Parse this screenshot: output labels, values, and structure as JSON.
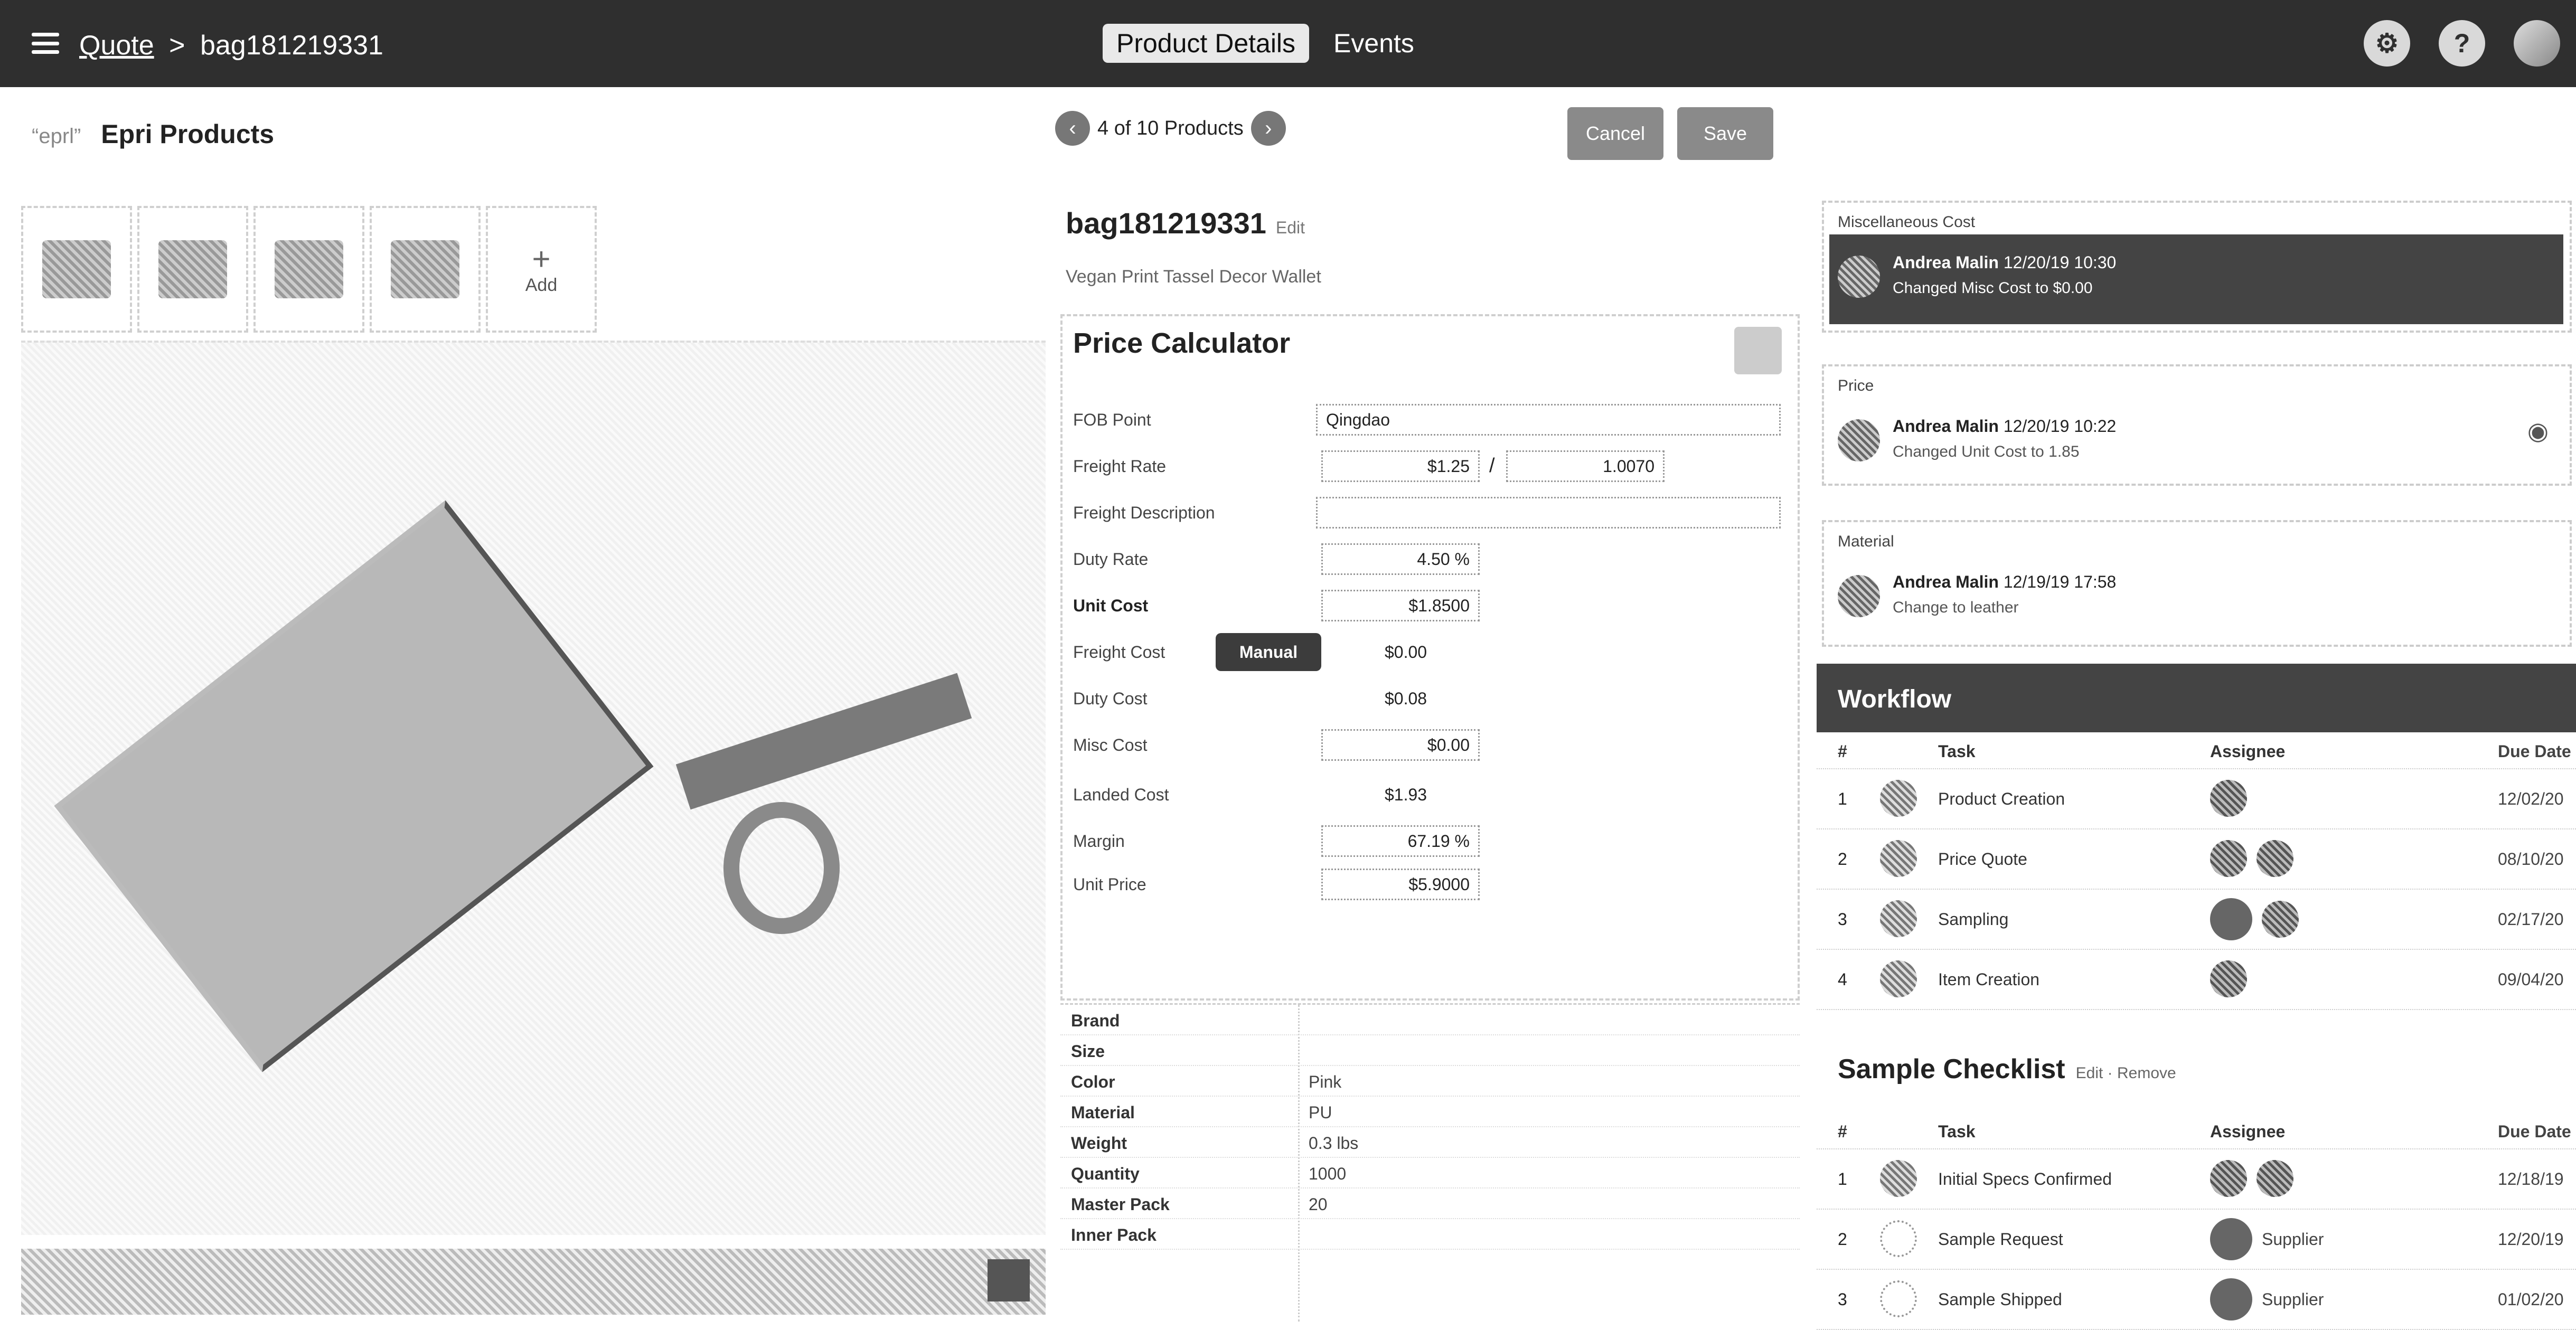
{
  "topbar": {
    "breadcrumb_root": "Quote",
    "breadcrumb_sep": ">",
    "breadcrumb_current": "bag181219331",
    "tabs": [
      {
        "label": "Product Details",
        "active": true
      },
      {
        "label": "Events",
        "active": false
      }
    ],
    "icons": [
      "settings-icon",
      "help-icon",
      "user-avatar"
    ],
    "help_glyph": "?"
  },
  "left": {
    "logo_text": "“eprl”",
    "title": "Epri Products",
    "add_thumb_label": "Add",
    "add_thumb_glyph": "+"
  },
  "middle": {
    "pager_text": "4 of 10 Products",
    "pager_prev": "‹",
    "pager_next": "›",
    "buttons": [
      "Cancel",
      "Save"
    ],
    "product_id": "bag181219331",
    "product_id_edit": "Edit",
    "product_desc": "Vegan Print Tassel Decor Wallet",
    "calc": {
      "title": "Price Calculator",
      "rows": [
        {
          "label": "FOB Point",
          "value": "Qingdao"
        },
        {
          "label": "Freight Rate",
          "value": "$1.25",
          "value2": "1.0070"
        },
        {
          "label": "Freight Description",
          "value": ""
        },
        {
          "label": "Duty Rate",
          "value": "4.50 %"
        },
        {
          "label": "Unit Cost",
          "value": "$1.8500"
        },
        {
          "label": "Freight Cost",
          "value": "$0.00",
          "toggle": "Manual"
        },
        {
          "label": "Duty Cost",
          "value": "$0.08"
        },
        {
          "label": "Misc Cost",
          "value": "$0.00"
        },
        {
          "label": "Landed Cost",
          "value": "$1.93"
        },
        {
          "label": "Margin",
          "value": "67.19 %"
        },
        {
          "label": "Unit Price",
          "value": "$5.9000"
        }
      ]
    },
    "specs": [
      {
        "label": "Brand",
        "value": ""
      },
      {
        "label": "Size",
        "value": ""
      },
      {
        "label": "Color",
        "value": "Pink"
      },
      {
        "label": "Material",
        "value": "PU"
      },
      {
        "label": "Weight",
        "value": "0.3 lbs"
      },
      {
        "label": "Quantity",
        "value": "1000"
      },
      {
        "label": "Master Pack",
        "value": "20"
      },
      {
        "label": "Inner Pack",
        "value": ""
      }
    ]
  },
  "right": {
    "activities": [
      {
        "title": "Miscellaneous Cost",
        "user": "Andrea Malin",
        "when": "12/20/19 10:30",
        "change": "Changed Misc Cost to $0.00"
      },
      {
        "title": "Price",
        "user": "Andrea Malin",
        "when": "12/20/19 10:22",
        "change": "Changed Unit Cost to 1.85"
      },
      {
        "title": "Material",
        "user": "Andrea Malin",
        "when": "12/19/19 17:58",
        "change": "Change to leather"
      }
    ],
    "workflow": {
      "title": "Workflow",
      "headers": [
        "#",
        "Task",
        "Assignee",
        "Due Date"
      ],
      "rows": [
        {
          "num": "1",
          "task": "Product Creation",
          "due": "12/02/20"
        },
        {
          "num": "2",
          "task": "Price Quote",
          "due": "08/10/20"
        },
        {
          "num": "3",
          "task": "Sampling",
          "due": "02/17/20"
        },
        {
          "num": "4",
          "task": "Item Creation",
          "due": "09/04/20"
        }
      ]
    },
    "checklist": {
      "title": "Sample Checklist",
      "subtitle": "Edit · Remove",
      "headers": [
        "#",
        "Task",
        "Assignee",
        "Due Date"
      ],
      "rows": [
        {
          "num": "1",
          "task": "Initial Specs Confirmed",
          "assignee": "",
          "due": "12/18/19"
        },
        {
          "num": "2",
          "task": "Sample Request",
          "assignee": "Supplier",
          "due": "12/20/19"
        },
        {
          "num": "3",
          "task": "Sample Shipped",
          "assignee": "Supplier",
          "due": "01/02/20"
        }
      ]
    }
  }
}
